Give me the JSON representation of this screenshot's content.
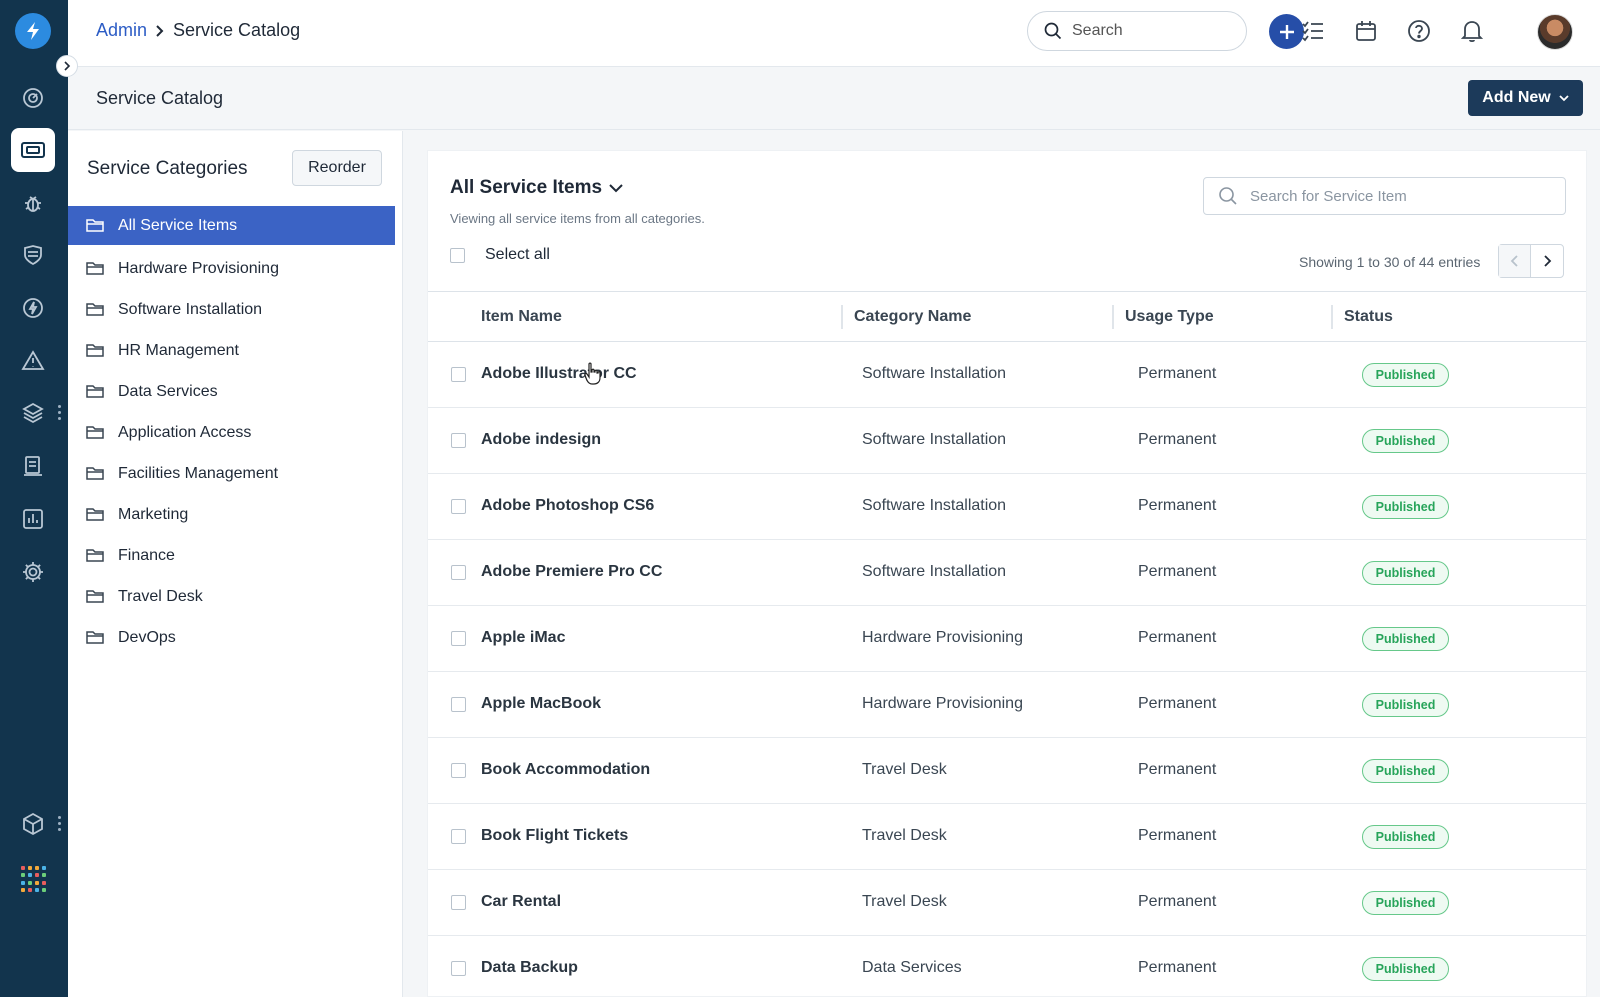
{
  "topbar": {
    "breadcrumb_parent": "Admin",
    "breadcrumb_current": "Service Catalog",
    "search_placeholder": "Search"
  },
  "subheader": {
    "title": "Service Catalog",
    "add_new_label": "Add New"
  },
  "categories": {
    "title": "Service Categories",
    "reorder_label": "Reorder",
    "items": [
      {
        "label": "All Service Items",
        "active": true
      },
      {
        "label": "Hardware Provisioning",
        "active": false
      },
      {
        "label": "Software Installation",
        "active": false
      },
      {
        "label": "HR Management",
        "active": false
      },
      {
        "label": "Data Services",
        "active": false
      },
      {
        "label": "Application Access",
        "active": false
      },
      {
        "label": "Facilities Management",
        "active": false
      },
      {
        "label": "Marketing",
        "active": false
      },
      {
        "label": "Finance",
        "active": false
      },
      {
        "label": "Travel Desk",
        "active": false
      },
      {
        "label": "DevOps",
        "active": false
      }
    ]
  },
  "main": {
    "view_title": "All Service Items",
    "view_subtitle": "Viewing all service items from all categories.",
    "search_placeholder": "Search for Service Item",
    "select_all_label": "Select all",
    "showing_text": "Showing 1 to 30 of 44 entries",
    "columns": {
      "item_name": "Item Name",
      "category_name": "Category Name",
      "usage_type": "Usage Type",
      "status": "Status"
    },
    "rows": [
      {
        "name": "Adobe Illustrator CC",
        "category": "Software Installation",
        "usage": "Permanent",
        "status": "Published"
      },
      {
        "name": "Adobe indesign",
        "category": "Software Installation",
        "usage": "Permanent",
        "status": "Published"
      },
      {
        "name": "Adobe Photoshop CS6",
        "category": "Software Installation",
        "usage": "Permanent",
        "status": "Published"
      },
      {
        "name": "Adobe Premiere Pro CC",
        "category": "Software Installation",
        "usage": "Permanent",
        "status": "Published"
      },
      {
        "name": "Apple iMac",
        "category": "Hardware Provisioning",
        "usage": "Permanent",
        "status": "Published"
      },
      {
        "name": "Apple MacBook",
        "category": "Hardware Provisioning",
        "usage": "Permanent",
        "status": "Published"
      },
      {
        "name": "Book Accommodation",
        "category": "Travel Desk",
        "usage": "Permanent",
        "status": "Published"
      },
      {
        "name": "Book Flight Tickets",
        "category": "Travel Desk",
        "usage": "Permanent",
        "status": "Published"
      },
      {
        "name": "Car Rental",
        "category": "Travel Desk",
        "usage": "Permanent",
        "status": "Published"
      },
      {
        "name": "Data Backup",
        "category": "Data Services",
        "usage": "Permanent",
        "status": "Published"
      }
    ]
  },
  "colors": {
    "nav_bg": "#12344d",
    "accent": "#3b63c5",
    "primary_button": "#1c3a5a",
    "published_green": "#27a45a"
  },
  "icons": [
    "logo-bolt-icon",
    "dashboard-icon",
    "tickets-icon",
    "bug-icon",
    "shield-icon",
    "bolt-icon",
    "alert-icon",
    "layers-icon",
    "document-icon",
    "reports-icon",
    "settings-icon",
    "box-icon",
    "apps-grid-icon",
    "search-icon",
    "plus-icon",
    "todo-icon",
    "calendar-icon",
    "help-icon",
    "bell-icon",
    "folder-icon",
    "chevron-down-icon",
    "chevron-left-icon",
    "chevron-right-icon"
  ]
}
